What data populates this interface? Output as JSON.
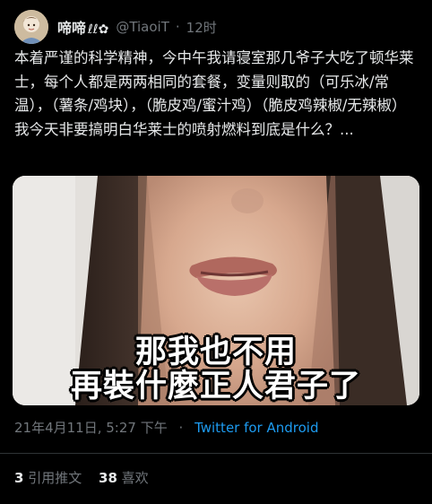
{
  "tweet": {
    "display_name": "啼啼",
    "handle": "@TiaoiT",
    "separator": "·",
    "time_ago": "12时",
    "text": "本着严谨的科学精神，今中午我请寝室那几爷子大吃了顿华莱士，每个人都是两两相同的套餐，变量则取的（可乐冰/常温），（薯条/鸡块），（脆皮鸡/蜜汁鸡）（脆皮鸡辣椒/无辣椒）我今天非要搞明白华莱士的喷射燃料到底是什么？...",
    "media": {
      "caption_line1": "那我也不用",
      "caption_line2": "再裝什麼正人君子了"
    },
    "date": "21年4月11日, 5:27 下午",
    "meta_separator": "·",
    "source": "Twitter for Android",
    "stats": {
      "quotes_count": "3",
      "quotes_label": "引用推文",
      "likes_count": "38",
      "likes_label": "喜欢"
    }
  },
  "colors": {
    "background": "#000000",
    "text_primary": "#e7e9ea",
    "text_secondary": "#71767b",
    "link": "#1d9bf0",
    "divider": "#2f3336"
  },
  "icons": [
    "avatar",
    "name-emoji-icon"
  ]
}
